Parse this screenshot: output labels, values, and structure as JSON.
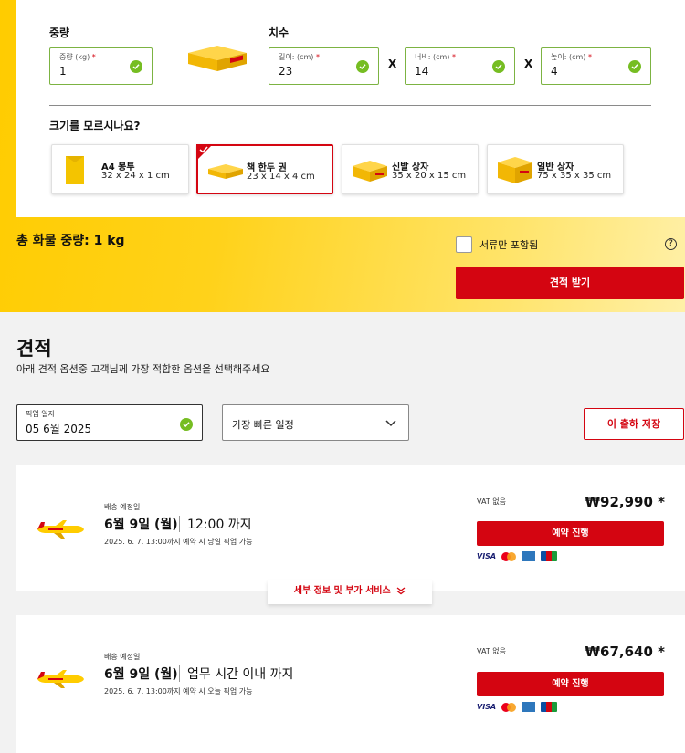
{
  "package": {
    "weight_heading": "중량",
    "weight_field": {
      "label": "중량 (kg)",
      "required_mark": "*",
      "value": "1"
    },
    "dimensions_heading": "치수",
    "length_field": {
      "label": "길이: (cm)",
      "required_mark": "*",
      "value": "23"
    },
    "width_field": {
      "label": "너비: (cm)",
      "required_mark": "*",
      "value": "14"
    },
    "height_field": {
      "label": "높이: (cm)",
      "required_mark": "*",
      "value": "4"
    },
    "separator": "X",
    "size_help": "크기를 모르시나요?",
    "presets": [
      {
        "name": "A4 봉투",
        "dims": "32 x 24 x 1 cm",
        "selected": false
      },
      {
        "name": "책 한두 권",
        "dims": "23 x 14 x 4 cm",
        "selected": true
      },
      {
        "name": "신발 상자",
        "dims": "35 x 20 x 15 cm",
        "selected": false
      },
      {
        "name": "일반 상자",
        "dims": "75 x 35 x 35 cm",
        "selected": false
      }
    ]
  },
  "summary": {
    "total_weight": "총 화물 중량: 1 kg",
    "documents_only_label": "서류만 포함됨",
    "info_icon": "?",
    "get_quote_button": "견적 받기"
  },
  "quote": {
    "title": "견적",
    "subtitle": "아래 견적 옵션중 고객님께 가장 적합한 옵션을 선택해주세요",
    "pickup_date": {
      "label": "픽업 일자",
      "value": "05 6월 2025"
    },
    "sort_select": {
      "value": "가장 빠른 일정"
    },
    "save_button": "이 출하 저장",
    "details_tab": "세부 정보 및 부가 서비스",
    "options": [
      {
        "delivery_label": "배송 예정일",
        "date": "6월 9일 (월)",
        "time": "12:00 까지",
        "note": "2025. 6. 7. 13:00까지 예약 시 당일 픽업 가능",
        "vat": "VAT 없음",
        "price": "₩92,990 *",
        "book_button": "예약 진행"
      },
      {
        "delivery_label": "배송 예정일",
        "date": "6월 9일 (월)",
        "time": "업무 시간 이내 까지",
        "note": "2025. 6. 7. 13:00까지 예약 시 오늘 픽업 가능",
        "vat": "VAT 없음",
        "price": "₩67,640 *",
        "book_button": "예약 진행"
      }
    ],
    "payment_icons": [
      "visa-icon",
      "mastercard-icon",
      "amex-icon",
      "jcb-icon"
    ],
    "payment_visa_text": "VISA"
  },
  "colors": {
    "brand_red": "#d40511",
    "brand_yellow": "#ffcc00",
    "valid_green": "#76bd22"
  }
}
